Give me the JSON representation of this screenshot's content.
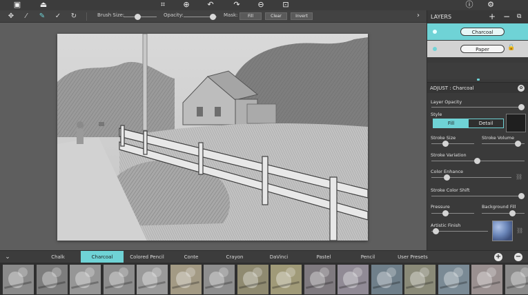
{
  "colors": {
    "accent": "#6fd3d6",
    "panel": "#3a3a3a",
    "toolbar": "#424242"
  },
  "topbar": {
    "left_icons": [
      "image-frame-icon",
      "export-tray-icon"
    ],
    "center_icons": [
      "crop-icon",
      "zoom-in-icon",
      "undo-icon",
      "redo-icon",
      "zoom-out-icon",
      "fit-screen-icon"
    ],
    "right_icons": [
      "info-icon",
      "settings-icon"
    ]
  },
  "toolbar": {
    "brush_size_label": "Brush Size:",
    "opacity_label": "Opacity:",
    "mask_label": "Mask:",
    "fill_label": "Fill",
    "clear_label": "Clear",
    "invert_label": "Invert"
  },
  "layers": {
    "title": "LAYERS",
    "items": [
      {
        "name": "Charcoal",
        "selected": true
      },
      {
        "name": "Paper",
        "selected": false,
        "locked": true
      }
    ]
  },
  "adjust": {
    "title": "ADJUST : Charcoal",
    "layer_opacity": "Layer Opacity",
    "style": "Style",
    "style_options": [
      "Fill",
      "Detail"
    ],
    "stroke_size": "Stroke Size",
    "stroke_volume": "Stroke Volume",
    "stroke_variation": "Stroke Variation",
    "color_enhance": "Color Enhance",
    "stroke_color_shift": "Stroke Color Shift",
    "pressure": "Pressure",
    "background_fill": "Background Fill",
    "artistic_finish": "Artistic Finish"
  },
  "presets": {
    "tabs": [
      "Chalk",
      "Charcoal",
      "Colored Pencil",
      "Conte",
      "Crayon",
      "DaVinci",
      "Pastel",
      "Pencil",
      "User Presets"
    ],
    "active": "Charcoal"
  },
  "thumbnails": {
    "colors": [
      "#8a8a8a",
      "#7d7d7d",
      "#969696",
      "#8c8c8c",
      "#9a9a9a",
      "#a39a84",
      "#8e8e8e",
      "#8f8a70",
      "#a09a78",
      "#7f7a7f",
      "#908a95",
      "#6f7f8a",
      "#8a8a78",
      "#7a8a95",
      "#9a9090",
      "#8a8a8a"
    ]
  }
}
